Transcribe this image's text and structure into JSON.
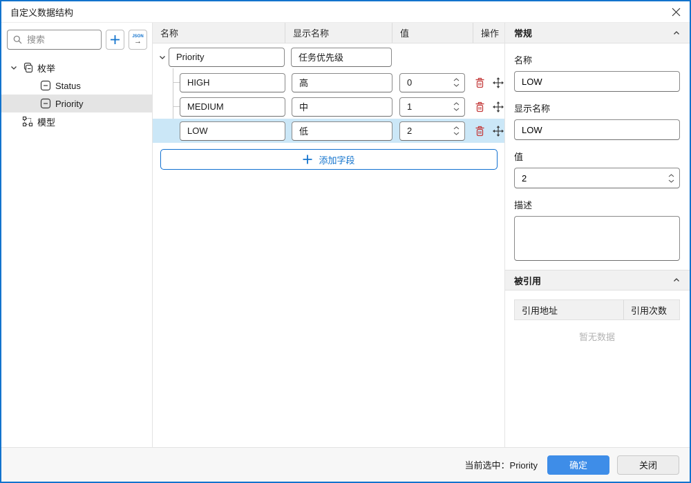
{
  "window": {
    "title": "自定义数据结构"
  },
  "sidebar": {
    "search_placeholder": "搜索",
    "json_button_label": "JSON",
    "json_button_arrow": "→",
    "tree": [
      {
        "label": "枚举"
      },
      {
        "label": "Status"
      },
      {
        "label": "Priority"
      },
      {
        "label": "模型"
      }
    ]
  },
  "table": {
    "columns": [
      "名称",
      "显示名称",
      "值",
      "操作"
    ],
    "parent_row": {
      "name": "Priority",
      "display_name": "任务优先级"
    },
    "rows": [
      {
        "name": "HIGH",
        "display_name": "高",
        "value": "0"
      },
      {
        "name": "MEDIUM",
        "display_name": "中",
        "value": "1"
      },
      {
        "name": "LOW",
        "display_name": "低",
        "value": "2"
      }
    ],
    "add_field_label": "添加字段"
  },
  "properties": {
    "general_title": "常规",
    "name_label": "名称",
    "name_value": "LOW",
    "display_label": "显示名称",
    "display_value": "LOW",
    "value_label": "值",
    "value_value": "2",
    "desc_label": "描述",
    "desc_value": "",
    "referenced": {
      "title": "被引用",
      "columns": [
        "引用地址",
        "引用次数"
      ],
      "empty_text": "暂无数据"
    }
  },
  "footer": {
    "selected_text": "当前选中：Priority",
    "ok_label": "确定",
    "close_label": "关闭"
  },
  "colors": {
    "accent_blue": "#1273cd",
    "primary_button": "#3e8de8",
    "selected_row": "#cbe7f7",
    "selected_tree_item": "#e4e4e4",
    "danger_red": "#c43c3c",
    "header_gray": "#f1f1f1"
  }
}
